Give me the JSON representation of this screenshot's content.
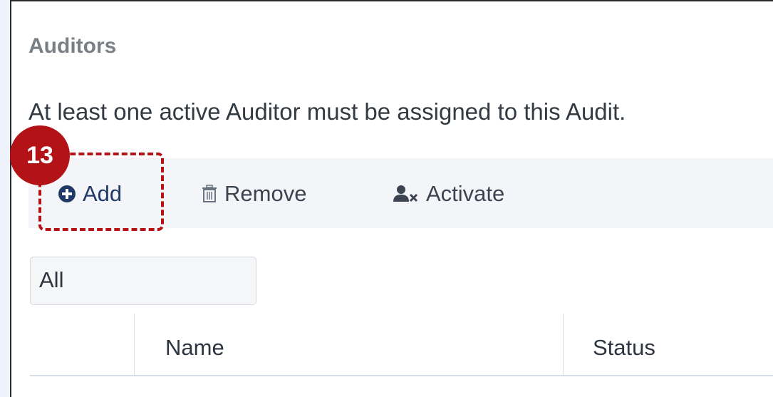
{
  "section": {
    "title": "Auditors",
    "help_text": "At least one active Auditor must be assigned to this Audit."
  },
  "toolbar": {
    "add_label": "Add",
    "add_icon": "plus-circle-icon",
    "remove_label": "Remove",
    "remove_icon": "trash-icon",
    "activate_label": "Activate",
    "activate_icon": "user-x-icon"
  },
  "filter": {
    "selected": "All"
  },
  "grid": {
    "columns": [
      "Name",
      "Status"
    ]
  },
  "callout": {
    "step_number": "13",
    "color": "#b31217"
  },
  "colors": {
    "accent": "#1f3a66",
    "page_background": "#eef3fb"
  }
}
